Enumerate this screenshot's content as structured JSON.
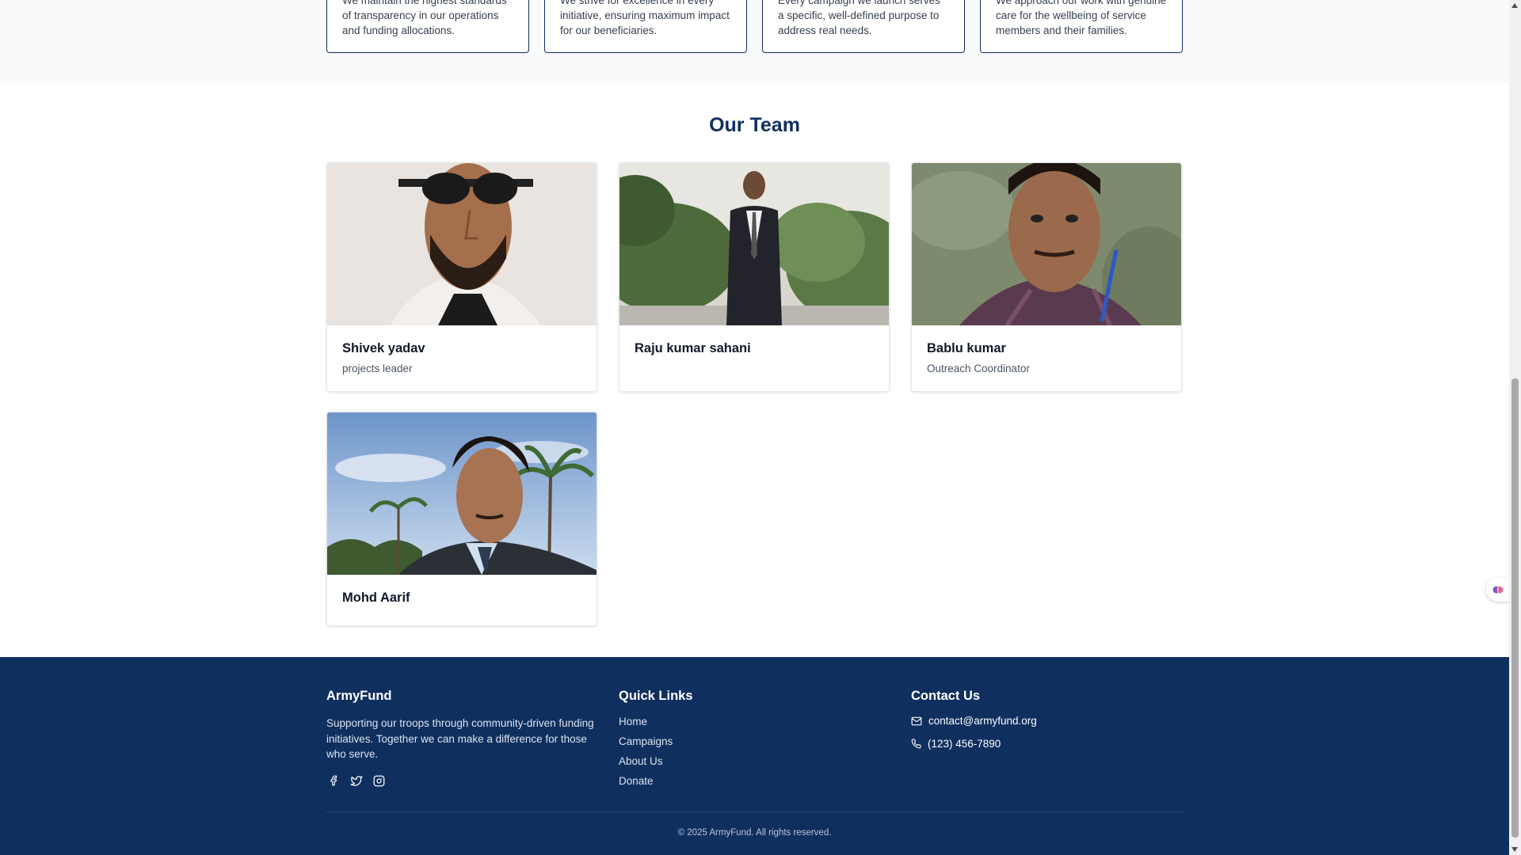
{
  "values": [
    {
      "text": "We maintain the highest standards of transparency in our operations and funding allocations."
    },
    {
      "text": "We strive for excellence in every initiative, ensuring maximum impact for our beneficiaries."
    },
    {
      "text": "Every campaign we launch serves a specific, well-defined purpose to address real needs."
    },
    {
      "text": "We approach our work with genuine care for the wellbeing of service members and their families."
    }
  ],
  "team": {
    "title": "Our Team",
    "members": [
      {
        "name": "Shivek yadav",
        "role": "projects leader"
      },
      {
        "name": "Raju kumar sahani",
        "role": ""
      },
      {
        "name": "Bablu kumar",
        "role": "Outreach Coordinator"
      },
      {
        "name": "Mohd Aarif",
        "role": ""
      }
    ]
  },
  "footer": {
    "brand": "ArmyFund",
    "tagline": "Supporting our troops through community-driven funding initiatives. Together we can make a difference for those who serve.",
    "social_icons": [
      "facebook-icon",
      "twitter-icon",
      "instagram-icon"
    ],
    "quick_links_title": "Quick Links",
    "quick_links": [
      "Home",
      "Campaigns",
      "About Us",
      "Donate"
    ],
    "contact_title": "Contact Us",
    "email": "contact@armyfund.org",
    "phone": "(123) 456-7890",
    "copyright": "© 2025 ArmyFund. All rights reserved."
  },
  "colors": {
    "navy": "#0f2f5f",
    "band": "#f9fafb"
  }
}
